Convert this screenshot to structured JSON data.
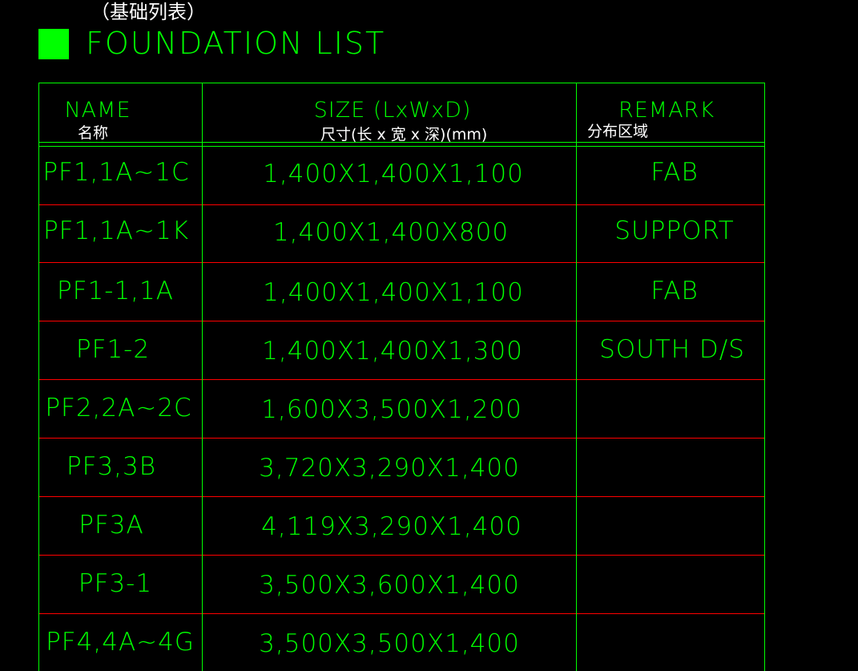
{
  "title": {
    "chinese": "（基础列表）",
    "english": "FOUNDATION LIST"
  },
  "colors": {
    "background": "#000000",
    "text": "#00ff00",
    "grid_outer": "#00ff00",
    "grid_row_divider": "#ff0000",
    "chinese_text": "#ffffff",
    "marker": "#00ff00"
  },
  "table": {
    "headers": [
      {
        "en": "NAME",
        "cn": "名称"
      },
      {
        "en": "SIZE (LxWxD)",
        "cn": "尺寸(长 x 宽 x 深)(mm)"
      },
      {
        "en": "REMARK",
        "cn": "分布区域"
      }
    ],
    "rows": [
      {
        "name": "PF1,1A~1C",
        "size": "1,400X1,400X1,100",
        "remark": "FAB"
      },
      {
        "name": "PF1,1A~1K",
        "size": "1,400X1,400X800",
        "remark": "SUPPORT"
      },
      {
        "name": "PF1-1,1A",
        "size": "1,400X1,400X1,100",
        "remark": "FAB"
      },
      {
        "name": "PF1-2",
        "size": "1,400X1,400X1,300",
        "remark": "SOUTH D/S"
      },
      {
        "name": "PF2,2A~2C",
        "size": "1,600X3,500X1,200",
        "remark": ""
      },
      {
        "name": "PF3,3B",
        "size": "3,720X3,290X1,400",
        "remark": ""
      },
      {
        "name": "PF3A",
        "size": "4,119X3,290X1,400",
        "remark": ""
      },
      {
        "name": "PF3-1",
        "size": "3,500X3,600X1,400",
        "remark": ""
      },
      {
        "name": "PF4,4A~4G",
        "size": "3,500X3,500X1,400",
        "remark": ""
      }
    ]
  }
}
